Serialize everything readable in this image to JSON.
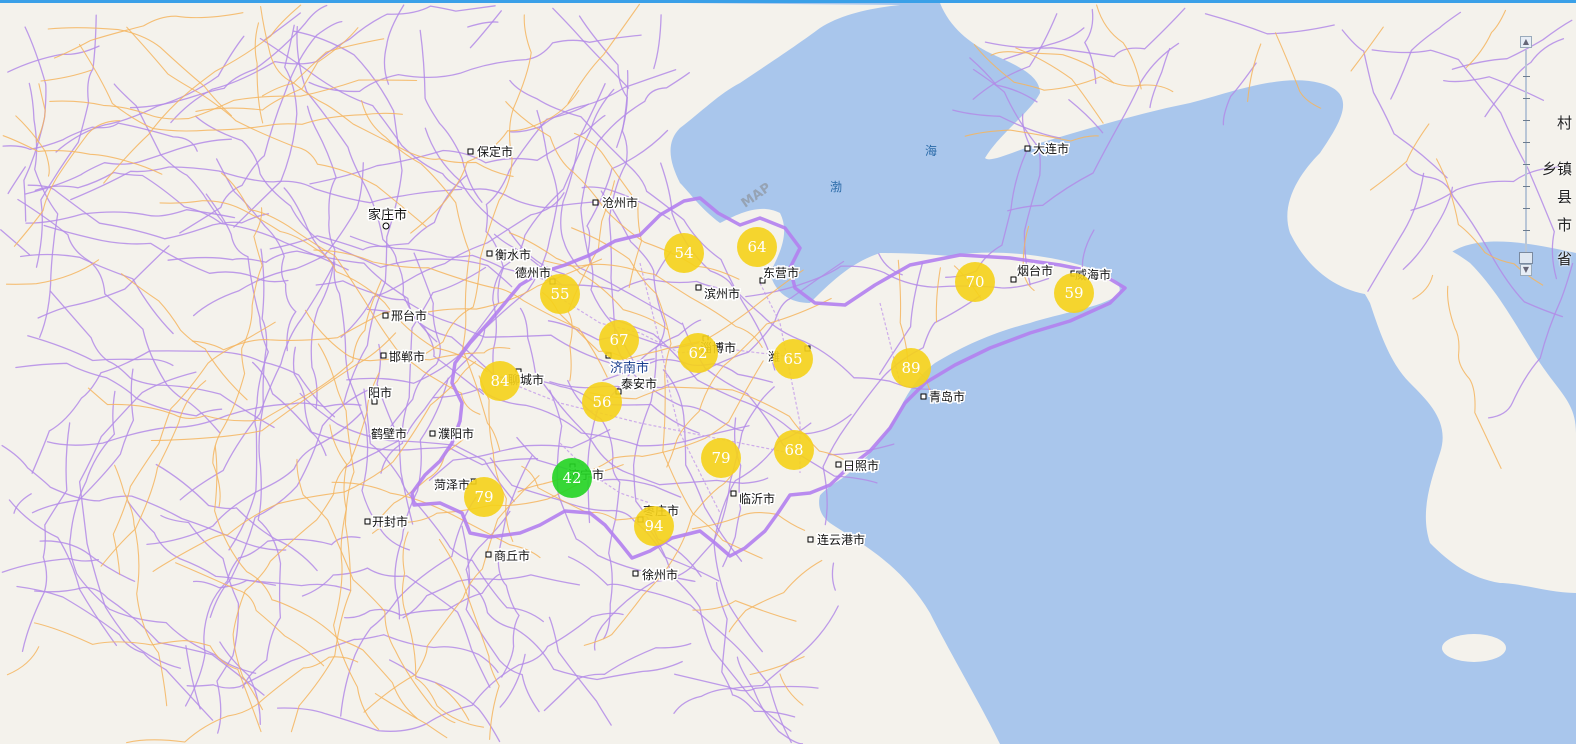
{
  "map": {
    "cities": [
      {
        "name": "保定市"
      },
      {
        "name": "沧州市"
      },
      {
        "name": "家庄市"
      },
      {
        "name": "衡水市"
      },
      {
        "name": "德州市"
      },
      {
        "name": "邢台市"
      },
      {
        "name": "邯郸市"
      },
      {
        "name": "阳市"
      },
      {
        "name": "鹤壁市"
      },
      {
        "name": "濮阳市"
      },
      {
        "name": "聊城市"
      },
      {
        "name": "济南市"
      },
      {
        "name": "泰安市"
      },
      {
        "name": "滨州市"
      },
      {
        "name": "东营市"
      },
      {
        "name": "淄博市"
      },
      {
        "name": "潍"
      },
      {
        "name": "烟台市"
      },
      {
        "name": "威海市"
      },
      {
        "name": "青岛市"
      },
      {
        "name": "日照市"
      },
      {
        "name": "临沂市"
      },
      {
        "name": "枣庄市"
      },
      {
        "name": "济宁市"
      },
      {
        "name": "菏泽市"
      },
      {
        "name": "开封市"
      },
      {
        "name": "商丘市"
      },
      {
        "name": "徐州市"
      },
      {
        "name": "连云港市"
      },
      {
        "name": "大连市"
      }
    ],
    "sea_labels": [
      "海",
      "渤"
    ],
    "watermark": "MAP",
    "clusters": [
      {
        "count": "54",
        "color": "#f5d21a"
      },
      {
        "count": "64",
        "color": "#f5d21a"
      },
      {
        "count": "55",
        "color": "#f5d21a"
      },
      {
        "count": "67",
        "color": "#f5d21a"
      },
      {
        "count": "62",
        "color": "#f5d21a"
      },
      {
        "count": "65",
        "color": "#f5d21a"
      },
      {
        "count": "70",
        "color": "#f5d21a"
      },
      {
        "count": "59",
        "color": "#f5d21a"
      },
      {
        "count": "84",
        "color": "#f5d21a"
      },
      {
        "count": "56",
        "color": "#f5d21a"
      },
      {
        "count": "89",
        "color": "#f5d21a"
      },
      {
        "count": "79",
        "color": "#f5d21a"
      },
      {
        "count": "68",
        "color": "#f5d21a"
      },
      {
        "count": "42",
        "color": "#22d422"
      },
      {
        "count": "79",
        "color": "#f5d21a"
      },
      {
        "count": "94",
        "color": "#f5d21a"
      }
    ],
    "colors": {
      "land": "#f4f2ec",
      "sea": "#a9c6ec",
      "province_border": "#b37ff0",
      "roads_major": "#f5b55f",
      "roads_minor": "#b38be8",
      "cluster_default": "#f5d21a",
      "cluster_highlight": "#22d422"
    }
  },
  "zoom": {
    "levels": [
      "村",
      "乡镇",
      "县",
      "市",
      "省"
    ],
    "plus_icon": "zoom-in-icon",
    "minus_icon": "zoom-out-icon"
  }
}
